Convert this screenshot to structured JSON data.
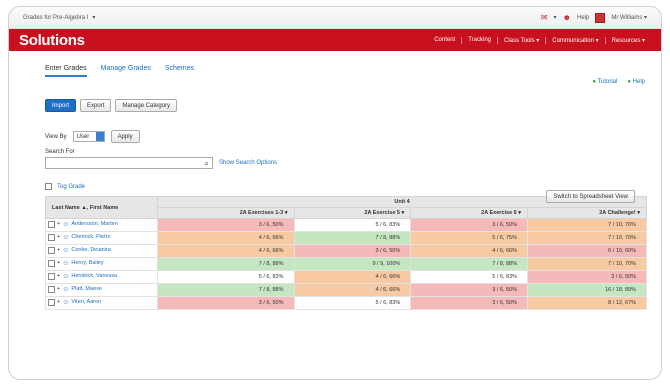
{
  "topbar": {
    "course_label": "Grades for Pre-Algebra I",
    "course_caret": "▾",
    "tools": [
      "▾",
      "Help"
    ],
    "user_name": "Mr Williams ▾"
  },
  "nav": {
    "brand": "Solutions",
    "menu": [
      "Content",
      "Tracking",
      "Class Tools ▾",
      "Communication ▾",
      "Resources ▾"
    ]
  },
  "tabs": [
    "Enter Grades",
    "Manage Grades",
    "Schemes"
  ],
  "help": {
    "tutorial": "Tutorial",
    "help": "Help"
  },
  "buttons": {
    "import": "Import",
    "export": "Export",
    "manage": "Manage Category"
  },
  "view": {
    "label": "View By",
    "select_value": "User",
    "apply": "Apply",
    "switch": "Switch to Spreadsheet View"
  },
  "search": {
    "label": "Search For",
    "placeholder": "",
    "options_link": "Show Search Options"
  },
  "table_controls": {
    "toggle": "Tog Grade"
  },
  "table": {
    "name_header": "Last Name ▲, First Name",
    "group_header": "Unit 4",
    "columns": [
      "2A Exercises 1-3 ▾",
      "2A Exercise 5 ▾",
      "2A Exercise 6 ▾",
      "2A Challenge! ▾"
    ],
    "rows": [
      {
        "name": "Andersson, Marten",
        "cells": [
          {
            "t": "3 / 6, 50%",
            "c": "red"
          },
          {
            "t": "5 / 6, 83%",
            "c": "white"
          },
          {
            "t": "3 / 6, 50%",
            "c": "red"
          },
          {
            "t": "7 / 10, 70%",
            "c": "orange"
          }
        ]
      },
      {
        "name": "Chernick, Pietro",
        "cells": [
          {
            "t": "4 / 6, 66%",
            "c": "orange"
          },
          {
            "t": "7 / 8, 88%",
            "c": "green"
          },
          {
            "t": "5 / 6, 75%",
            "c": "orange"
          },
          {
            "t": "7 / 10, 70%",
            "c": "orange"
          }
        ]
      },
      {
        "name": "Cooke, Deianira",
        "cells": [
          {
            "t": "4 / 6, 66%",
            "c": "orange"
          },
          {
            "t": "3 / 6, 50%",
            "c": "red"
          },
          {
            "t": "4 / 6, 66%",
            "c": "orange"
          },
          {
            "t": "6 / 10, 60%",
            "c": "red"
          }
        ]
      },
      {
        "name": "Henry, Bailey",
        "cells": [
          {
            "t": "7 / 8, 88%",
            "c": "green"
          },
          {
            "t": "9 / 9, 100%",
            "c": "green"
          },
          {
            "t": "7 / 8, 88%",
            "c": "green"
          },
          {
            "t": "7 / 10, 70%",
            "c": "orange"
          }
        ]
      },
      {
        "name": "Hendrick, Vanessa",
        "cells": [
          {
            "t": "5 / 6, 83%",
            "c": "white"
          },
          {
            "t": "4 / 6, 66%",
            "c": "orange"
          },
          {
            "t": "5 / 6, 83%",
            "c": "white"
          },
          {
            "t": "3 / 6, 50%",
            "c": "red"
          }
        ]
      },
      {
        "name": "Platt, Maeve",
        "cells": [
          {
            "t": "7 / 8, 88%",
            "c": "green"
          },
          {
            "t": "4 / 6, 66%",
            "c": "orange"
          },
          {
            "t": "3 / 6, 50%",
            "c": "red"
          },
          {
            "t": "16 / 18, 89%",
            "c": "green"
          }
        ]
      },
      {
        "name": "Viteri, Aaron",
        "cells": [
          {
            "t": "3 / 6, 50%",
            "c": "red"
          },
          {
            "t": "5 / 6, 83%",
            "c": "white"
          },
          {
            "t": "3 / 6, 50%",
            "c": "red"
          },
          {
            "t": "8 / 12, 67%",
            "c": "orange"
          }
        ]
      }
    ]
  },
  "colors": {
    "brand_red": "#c8101e",
    "low": "#f5b9b9",
    "mid": "#f7caa3",
    "high": "#c4e6c1",
    "link_blue": "#1a6fc2"
  }
}
